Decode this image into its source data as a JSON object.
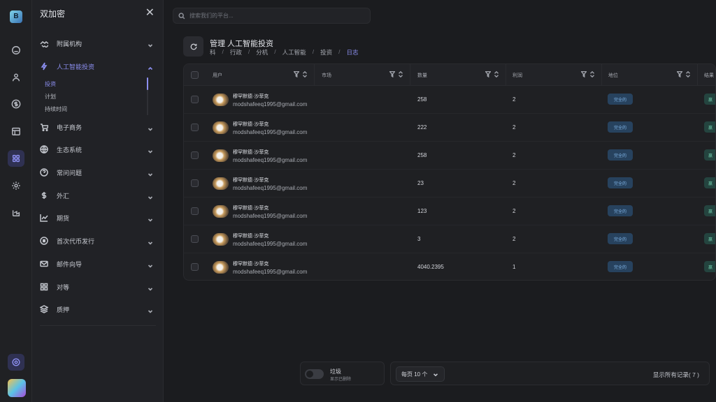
{
  "rail": {
    "logo_text": "B",
    "icons": [
      "home-icon",
      "user-icon",
      "dollar-icon",
      "calendar-icon",
      "apps-icon",
      "settings-icon",
      "chart-icon"
    ]
  },
  "sidebar": {
    "title": "双加密",
    "items": [
      {
        "label": "附属机构",
        "icon": "handshake-icon",
        "expanded": false
      },
      {
        "label": "人工智能投资",
        "icon": "bolt-icon",
        "expanded": true
      },
      {
        "label": "电子商务",
        "icon": "cart-icon",
        "expanded": false
      },
      {
        "label": "生态系统",
        "icon": "globe-icon",
        "expanded": false
      },
      {
        "label": "常问问题",
        "icon": "help-icon",
        "expanded": false
      },
      {
        "label": "外汇",
        "icon": "dollar-icon",
        "expanded": false
      },
      {
        "label": "期货",
        "icon": "trend-icon",
        "expanded": false
      },
      {
        "label": "首次代币发行",
        "icon": "coin-icon",
        "expanded": false
      },
      {
        "label": "邮件向导",
        "icon": "mail-icon",
        "expanded": false
      },
      {
        "label": "对等",
        "icon": "peer-icon",
        "expanded": false
      },
      {
        "label": "质押",
        "icon": "layers-icon",
        "expanded": false
      }
    ],
    "subitems": [
      {
        "label": "投资",
        "active": true
      },
      {
        "label": "计划",
        "active": false
      },
      {
        "label": "持续时间",
        "active": false
      }
    ]
  },
  "search": {
    "placeholder": "搜索我们的平台..."
  },
  "page": {
    "title": "管理 人工智能投资",
    "breadcrumb": [
      "科",
      "行政",
      "分机",
      "人工智能",
      "投资",
      "日志"
    ]
  },
  "table": {
    "columns": [
      "用户",
      "市场",
      "数量",
      "利润",
      "地位",
      "结果"
    ],
    "rows": [
      {
        "name": "穆罕默德·沙菲克",
        "email": "modshafeeq1995@gmail.com",
        "market": "",
        "qty": "258",
        "profit": "2",
        "status": "完全的",
        "result": "赢"
      },
      {
        "name": "穆罕默德·沙菲克",
        "email": "modshafeeq1995@gmail.com",
        "market": "",
        "qty": "222",
        "profit": "2",
        "status": "完全的",
        "result": "赢"
      },
      {
        "name": "穆罕默德·沙菲克",
        "email": "modshafeeq1995@gmail.com",
        "market": "",
        "qty": "258",
        "profit": "2",
        "status": "完全的",
        "result": "赢"
      },
      {
        "name": "穆罕默德·沙菲克",
        "email": "modshafeeq1995@gmail.com",
        "market": "",
        "qty": "23",
        "profit": "2",
        "status": "完全的",
        "result": "赢"
      },
      {
        "name": "穆罕默德·沙菲克",
        "email": "modshafeeq1995@gmail.com",
        "market": "",
        "qty": "123",
        "profit": "2",
        "status": "完全的",
        "result": "赢"
      },
      {
        "name": "穆罕默德·沙菲克",
        "email": "modshafeeq1995@gmail.com",
        "market": "",
        "qty": "3",
        "profit": "2",
        "status": "完全的",
        "result": "赢"
      },
      {
        "name": "穆罕默德·沙菲克",
        "email": "modshafeeq1995@gmail.com",
        "market": "",
        "qty": "4040.2395",
        "profit": "1",
        "status": "完全的",
        "result": "赢"
      }
    ]
  },
  "footer": {
    "trash_title": "垃圾",
    "trash_sub": "显示已删除",
    "per_page": "每页 10 个",
    "records": "显示所有记录( 7 )"
  },
  "colors": {
    "accent": "#8c8ff0",
    "status_bg": "#27425e",
    "status_text": "#7fb3e6",
    "result_bg": "#24443f"
  }
}
